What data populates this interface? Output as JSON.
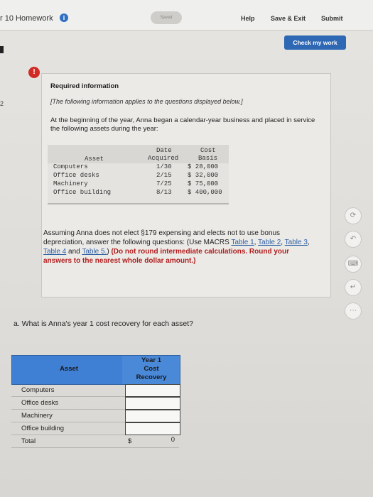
{
  "header": {
    "title": "r 10 Homework",
    "saved": "Saved",
    "help": "Help",
    "save_exit": "Save & Exit",
    "submit": "Submit",
    "check_my_work": "Check my work"
  },
  "sidebar": {
    "question_marker": "2"
  },
  "required": {
    "title": "Required information",
    "note": "[The following information applies to the questions displayed below.]",
    "intro": "At the beginning of the year, Anna began a calendar-year business and placed in service the following assets during the year:",
    "table": {
      "headers": {
        "asset": "Asset",
        "date1": "Date",
        "date2": "Acquired",
        "cost1": "Cost",
        "cost2": "Basis"
      },
      "rows": [
        {
          "asset": "Computers",
          "date": "1/30",
          "cost": "$ 28,000"
        },
        {
          "asset": "Office desks",
          "date": "2/15",
          "cost": "$ 32,000"
        },
        {
          "asset": "Machinery",
          "date": "7/25",
          "cost": "$ 75,000"
        },
        {
          "asset": "Office building",
          "date": "8/13",
          "cost": "$ 400,000"
        }
      ]
    },
    "question": {
      "lead": "Assuming Anna does not elect §179 expensing and elects not to use bonus depreciation, answer the following questions: (Use MACRS ",
      "links": [
        "Table 1",
        "Table 2",
        "Table 3",
        "Table 4",
        "Table 5."
      ],
      "close": ")",
      "instruction": "(Do not round intermediate calculations. Round your answers to the nearest whole dollar amount.)"
    }
  },
  "part_a": {
    "question": "a. What is Anna's year 1 cost recovery for each asset?",
    "table": {
      "col_asset": "Asset",
      "col_recovery": [
        "Year 1",
        "Cost",
        "Recovery"
      ],
      "rows": [
        {
          "label": "Computers",
          "value": ""
        },
        {
          "label": "Office desks",
          "value": ""
        },
        {
          "label": "Machinery",
          "value": ""
        },
        {
          "label": "Office building",
          "value": ""
        }
      ],
      "total_label": "Total",
      "total_currency": "$",
      "total_value": "0"
    }
  },
  "tools": [
    "refresh-icon",
    "undo-icon",
    "keyboard-icon",
    "return-icon",
    "more-icon"
  ],
  "colors": {
    "accent_blue": "#2e67b3",
    "alert_red": "#d02b24",
    "table_header_blue": "#3f7fd4"
  }
}
